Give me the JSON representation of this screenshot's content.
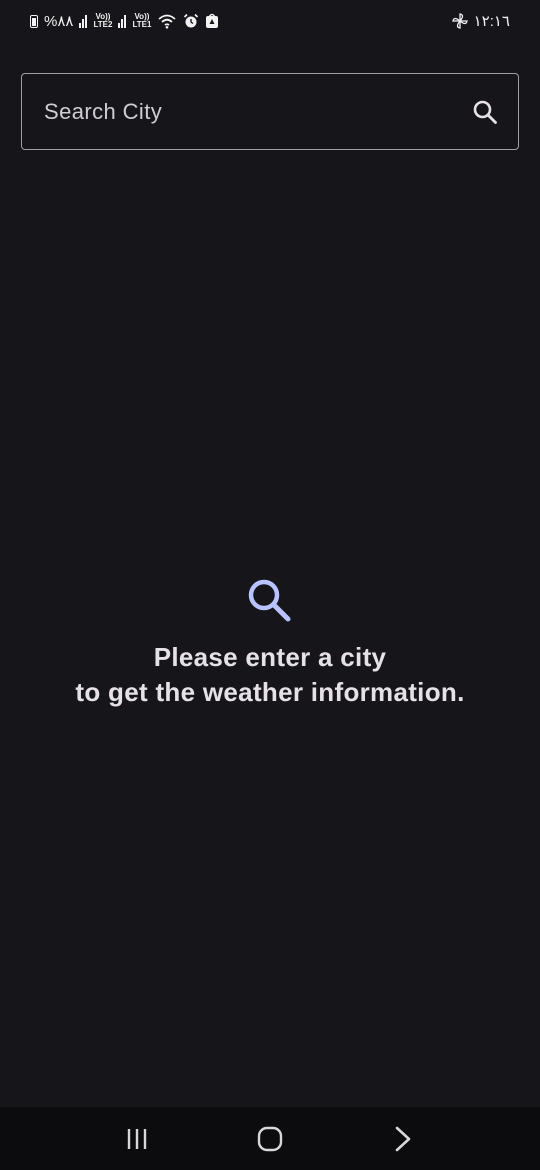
{
  "status_bar": {
    "battery_percent": "%٨٨",
    "sim2_label": "LTE2",
    "sim1_label": "LTE1",
    "volte": "Vo))",
    "time": "١٢:١٦",
    "icons": [
      "battery-icon",
      "signal-icon",
      "wifi-icon",
      "alarm-icon",
      "app-notification-icon",
      "pinwheel-icon"
    ]
  },
  "search": {
    "placeholder": "Search City",
    "icon": "search-icon"
  },
  "empty_state": {
    "icon": "search-icon",
    "line1": "Please enter a city",
    "line2": "to get the weather information.",
    "icon_color": "#b9c3ff"
  },
  "nav_bar": {
    "icons": [
      "recent-apps-icon",
      "home-icon",
      "back-icon"
    ]
  },
  "colors": {
    "background": "#16161a",
    "text": "#e6e1e6",
    "accent": "#b9c3ff",
    "outline": "#a19ea6"
  }
}
